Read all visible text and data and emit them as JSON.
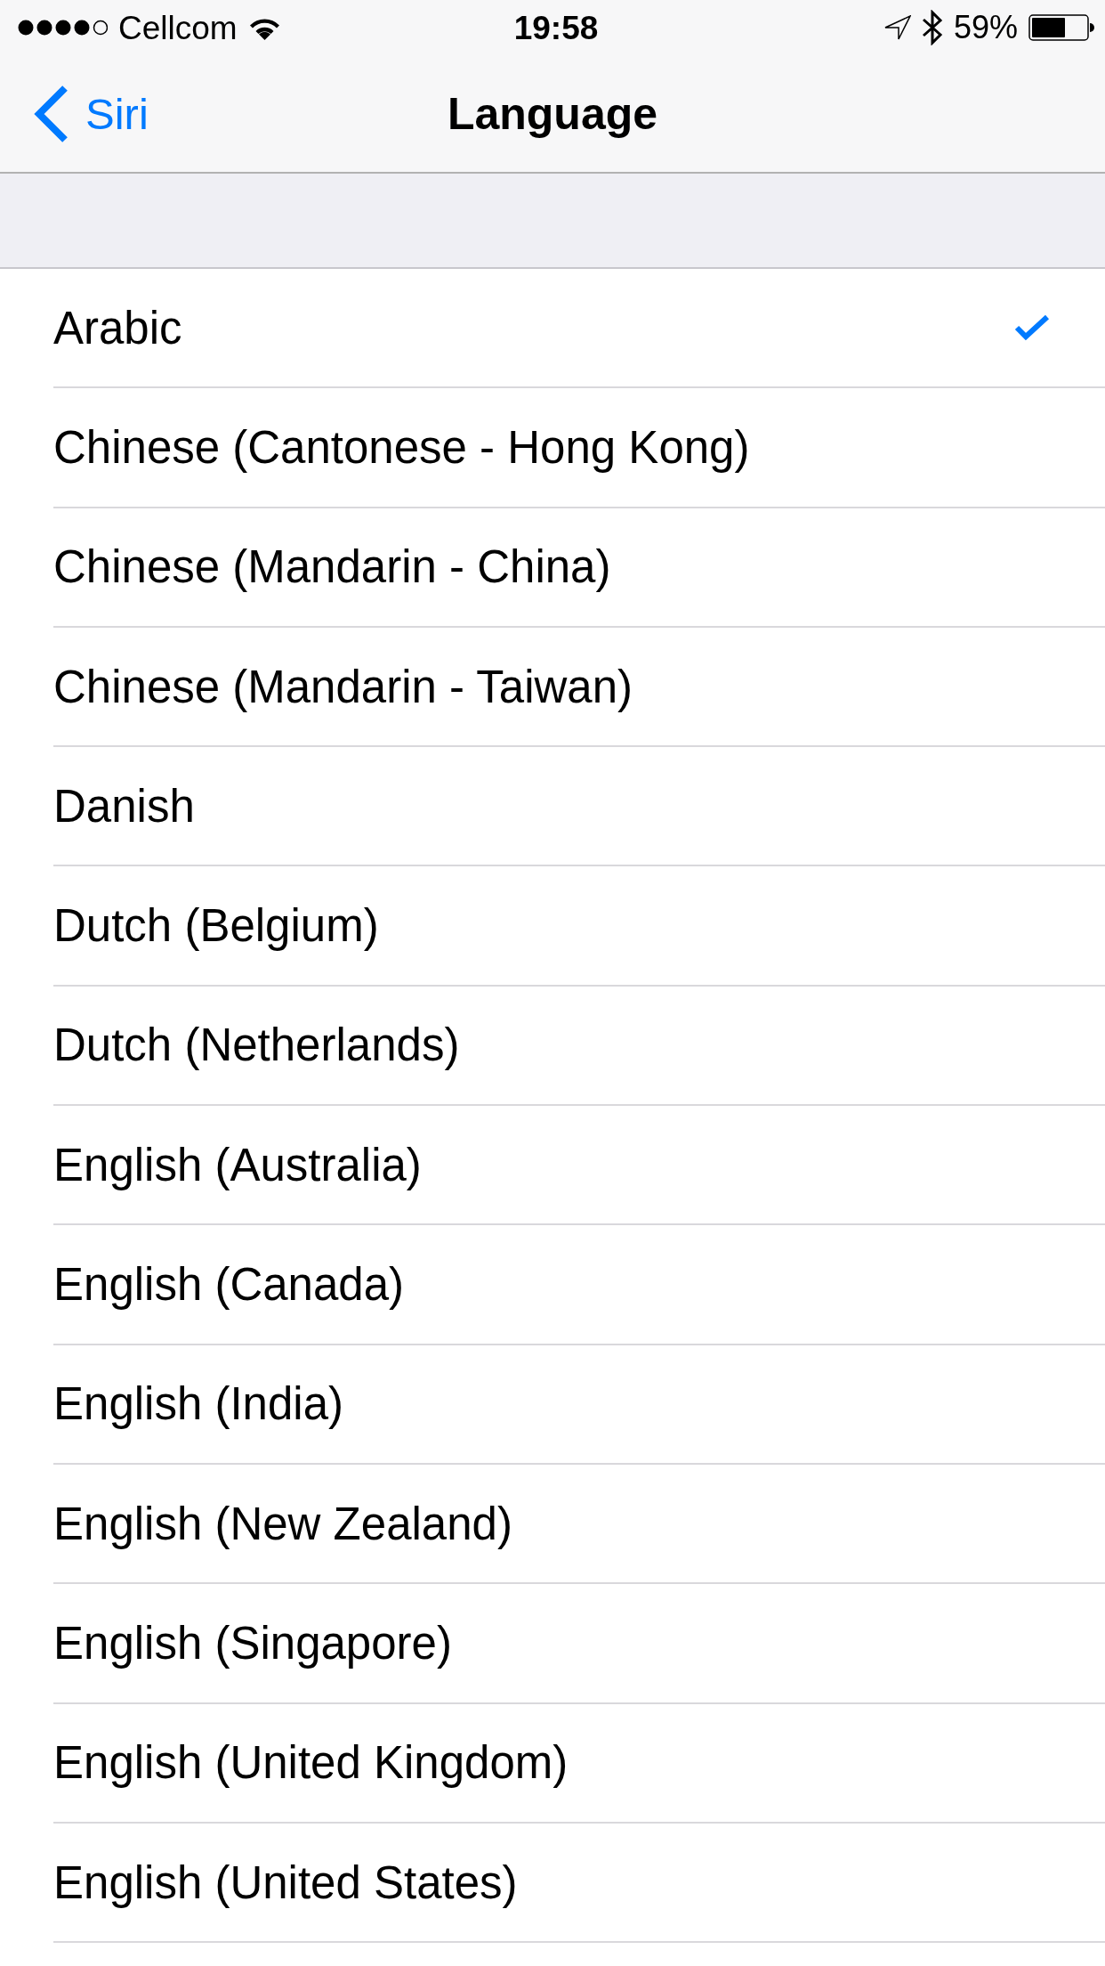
{
  "status_bar": {
    "carrier": "Cellcom",
    "time": "19:58",
    "battery": "59%"
  },
  "nav_bar": {
    "back": "Siri",
    "title": "Language"
  },
  "languages": [
    {
      "label": "Arabic",
      "selected": true
    },
    {
      "label": "Chinese (Cantonese - Hong Kong)",
      "selected": false
    },
    {
      "label": "Chinese (Mandarin - China)",
      "selected": false
    },
    {
      "label": "Chinese (Mandarin - Taiwan)",
      "selected": false
    },
    {
      "label": "Danish",
      "selected": false
    },
    {
      "label": "Dutch (Belgium)",
      "selected": false
    },
    {
      "label": "Dutch (Netherlands)",
      "selected": false
    },
    {
      "label": "English (Australia)",
      "selected": false
    },
    {
      "label": "English (Canada)",
      "selected": false
    },
    {
      "label": "English (India)",
      "selected": false
    },
    {
      "label": "English (New Zealand)",
      "selected": false
    },
    {
      "label": "English (Singapore)",
      "selected": false
    },
    {
      "label": "English (United Kingdom)",
      "selected": false
    },
    {
      "label": "English (United States)",
      "selected": false
    }
  ]
}
